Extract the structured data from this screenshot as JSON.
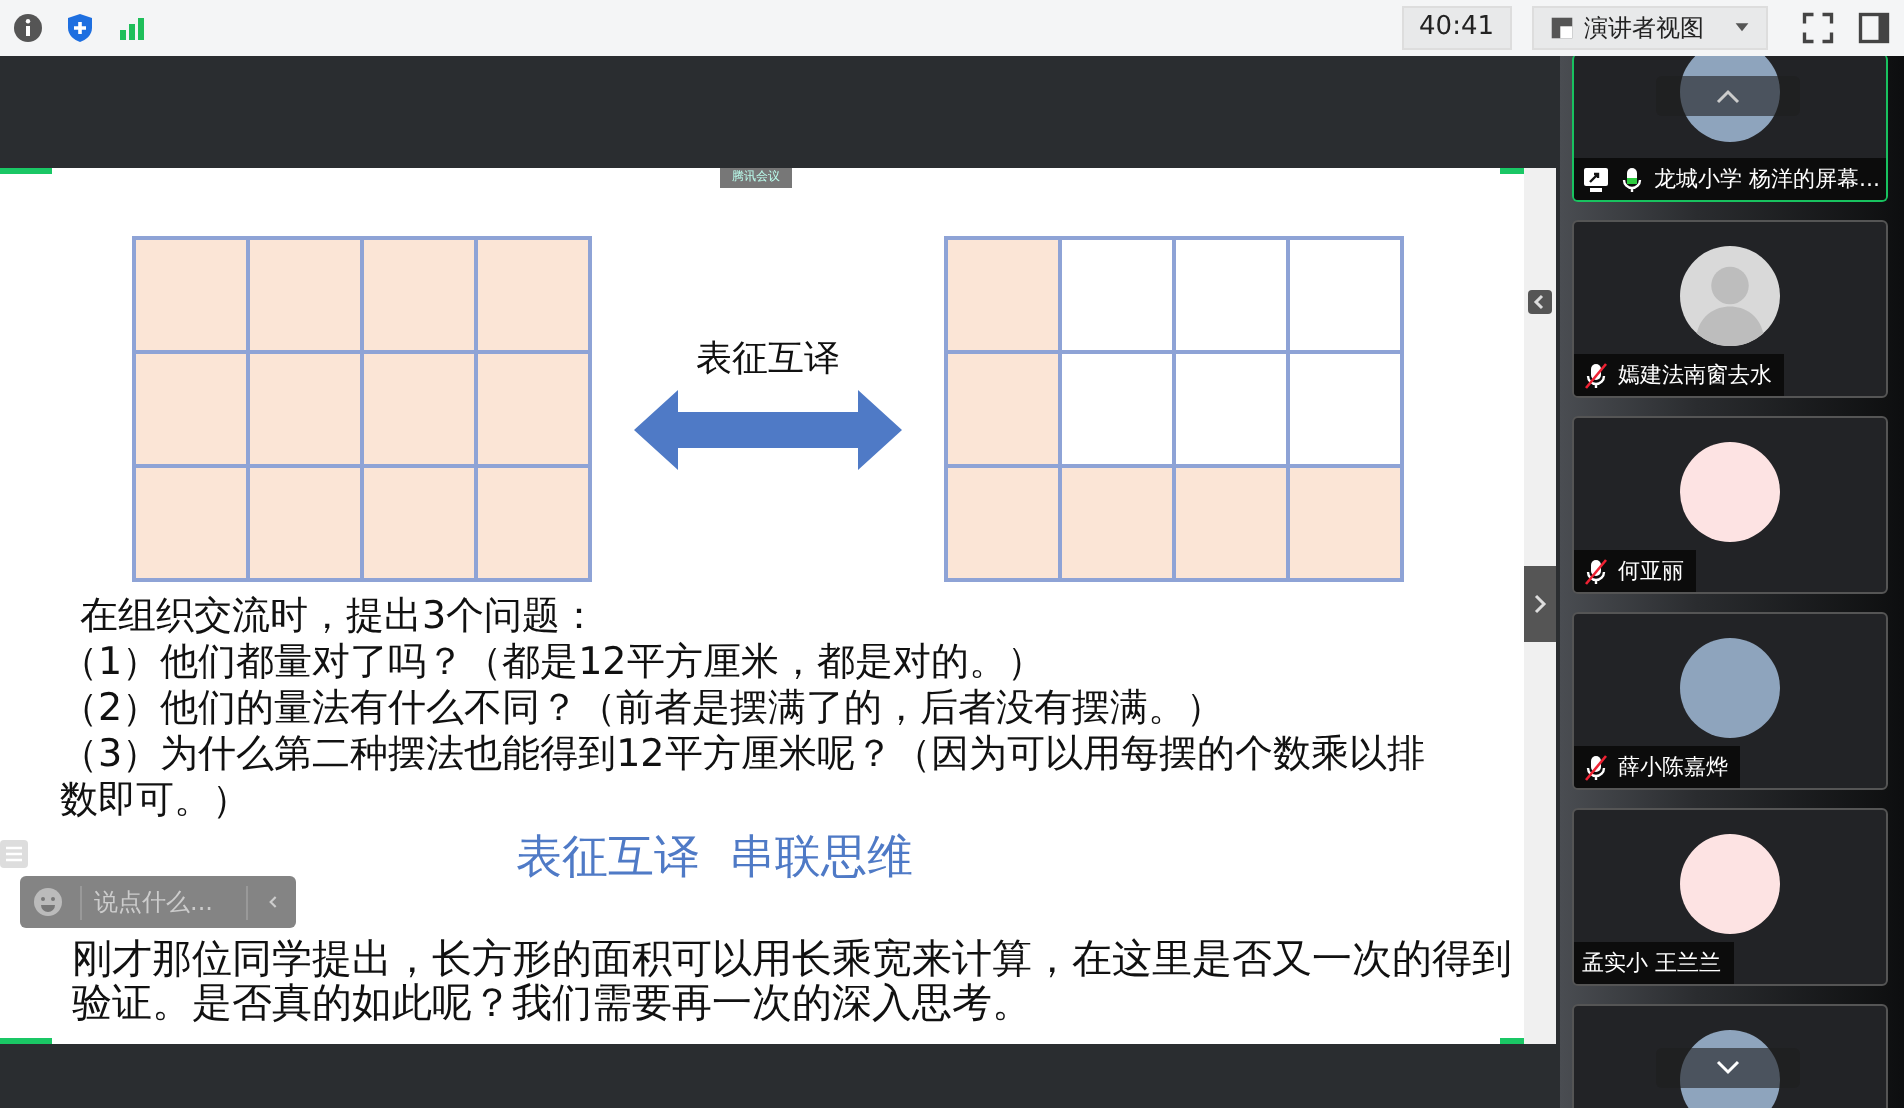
{
  "toolbar": {
    "timer": "40:41",
    "view_button": "演讲者视图"
  },
  "slide": {
    "badge": "腾讯会议",
    "grids": [
      {
        "rows": [
          [
            true,
            true,
            true,
            true
          ],
          [
            true,
            true,
            true,
            true
          ],
          [
            true,
            true,
            true,
            true
          ]
        ]
      },
      {
        "rows": [
          [
            true,
            false,
            false,
            false
          ],
          [
            true,
            false,
            false,
            false
          ],
          [
            true,
            true,
            true,
            true
          ]
        ]
      }
    ],
    "arrow_label": "表征互译",
    "intro": "在组织交流时，提出3个问题：",
    "questions": [
      "（1）他们都量对了吗？（都是12平方厘米，都是对的。）",
      "（2）他们的量法有什么不同？（前者是摆满了的，后者没有摆满。）",
      "（3）为什么第二种摆法也能得到12平方厘米呢？（因为可以用每摆的个数乘以排数即可。）"
    ],
    "subtitle": "表征互译  串联思维",
    "paragraph": "刚才那位同学提出，长方形的面积可以用长乘宽来计算，在这里是否又一次的得到验证。是否真的如此呢？我们需要再一次的深入思考。"
  },
  "chat": {
    "placeholder": "说点什么..."
  },
  "participants": [
    {
      "kind": "photo",
      "name": "龙城小学 杨洋的屏幕...",
      "mic_on": true,
      "muted": false,
      "sharing": true,
      "selected": true
    },
    {
      "kind": "silhouette",
      "name": "嫣建法南窗去水",
      "mic_on": false,
      "muted": true,
      "sharing": false,
      "selected": false
    },
    {
      "kind": "cartoon",
      "name": "何亚丽",
      "mic_on": false,
      "muted": true,
      "sharing": false,
      "selected": false
    },
    {
      "kind": "photo",
      "name": "薛小陈嘉烨",
      "mic_on": false,
      "muted": true,
      "sharing": false,
      "selected": false
    },
    {
      "kind": "cartoon",
      "name": "孟实小 王兰兰",
      "mic_on": false,
      "muted": false,
      "sharing": false,
      "selected": false
    },
    {
      "kind": "photo",
      "mic_on": false,
      "muted": false,
      "sharing": false,
      "selected": false
    }
  ]
}
